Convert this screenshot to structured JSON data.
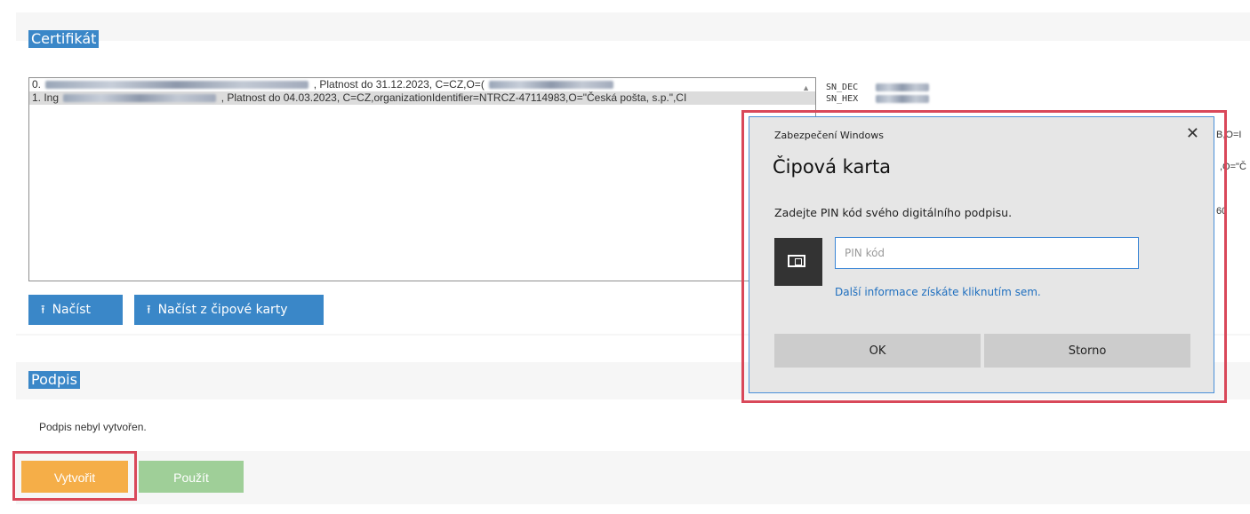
{
  "certificate_section": {
    "label": "Certifikát",
    "rows": [
      {
        "prefix": "0.",
        "suffix": ", Platnost do 31.12.2023, C=CZ,O=("
      },
      {
        "prefix": "1. Ing",
        "suffix": ", Platnost do 04.03.2023, C=CZ,organizationIdentifier=NTRCZ-47114983,O=\"Česká pošta, s.p.\",CI"
      }
    ],
    "sn_labels": [
      "SN_DEC",
      "SN_HEX"
    ],
    "right_fragments": [
      "B,O=I",
      ",O=\"Č",
      "60"
    ],
    "buttons": {
      "load": "Načíst",
      "load_card": "Načíst z čipové karty"
    }
  },
  "signature_section": {
    "label": "Podpis",
    "status": "Podpis nebyl vytvořen.",
    "buttons": {
      "create": "Vytvořit",
      "use": "Použít"
    }
  },
  "dialog": {
    "window_title": "Zabezpečení Windows",
    "heading": "Čipová karta",
    "prompt": "Zadejte PIN kód svého digitálního podpisu.",
    "pin_placeholder": "PIN kód",
    "more_info_link": "Další informace získáte kliknutím sem.",
    "ok": "OK",
    "cancel": "Storno",
    "close": "✕"
  },
  "colors": {
    "accent_blue": "#3a87c8",
    "highlight_red": "#d9485a",
    "create_orange": "#f5ae48",
    "use_green": "#9fcf98"
  }
}
